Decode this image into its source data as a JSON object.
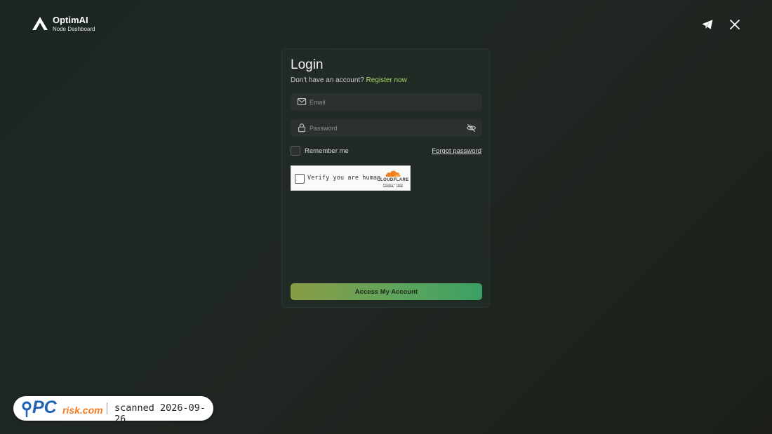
{
  "brand": {
    "name": "OptimAI",
    "subtitle": "Node Dashboard",
    "icon": "optimai-logo-icon"
  },
  "header_links": [
    {
      "icon": "telegram-icon"
    },
    {
      "icon": "x-icon"
    }
  ],
  "login": {
    "title": "Login",
    "prompt_text": "Don't have an account? ",
    "register_link": "Register now",
    "email": {
      "placeholder": "Email",
      "value": "",
      "icon": "mail-icon"
    },
    "password": {
      "placeholder": "Password",
      "value": "",
      "icon": "lock-icon",
      "toggle_icon": "eye-off-icon"
    },
    "remember_label": "Remember me",
    "remember_checked": false,
    "forgot_link": "Forgot password",
    "captcha": {
      "label": "Verify you are human",
      "provider": "CLOUDFLARE",
      "privacy": "Privacy",
      "separator": "•",
      "help": "Help",
      "icon": "cloudflare-cloud-icon"
    },
    "submit_label": "Access My Account"
  },
  "watermark": {
    "pc": "PC",
    "risk": "risk.com",
    "scan_text": "scanned 2026-09-26"
  },
  "colors": {
    "accent_link": "#a9d66a",
    "button_gradient_start": "#8a9c45",
    "button_gradient_end": "#3aa063",
    "card_bg": "#222a25",
    "input_bg": "#2b322e",
    "pcrisk_blue": "#1e63b4",
    "pcrisk_orange": "#f47b20",
    "cloudflare_orange": "#f38020"
  }
}
